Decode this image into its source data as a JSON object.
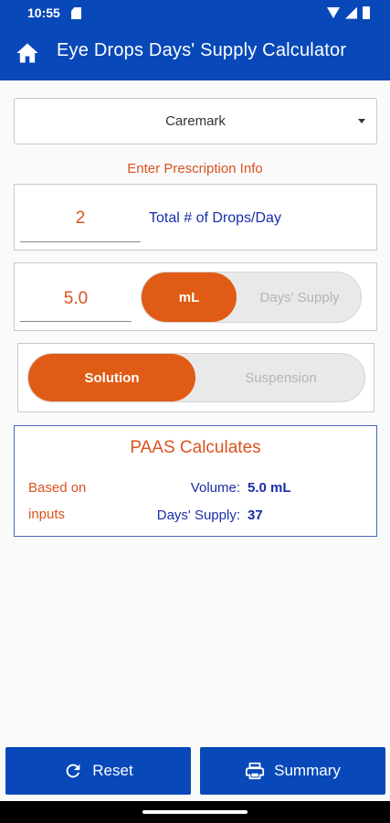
{
  "status_bar": {
    "time": "10:55"
  },
  "app_bar": {
    "title": "Eye Drops Days' Supply Calculator"
  },
  "pbm": {
    "selected": "Caremark"
  },
  "prescription": {
    "section_label": "Enter Prescription Info",
    "drops_per_day": "2",
    "drops_label": "Total # of Drops/Day",
    "volume_value": "5.0",
    "unit_toggle": {
      "selected": "mL",
      "other": "Days' Supply"
    },
    "form_toggle": {
      "selected": "Solution",
      "other": "Suspension"
    }
  },
  "results": {
    "title": "PAAS Calculates",
    "note": "Based on inputs",
    "volume_label": "Volume:",
    "volume_value": "5.0 mL",
    "days_supply_label": "Days' Supply:",
    "days_supply_value": "37"
  },
  "buttons": {
    "reset": "Reset",
    "summary": "Summary"
  },
  "colors": {
    "primary": "#0848b8",
    "accent": "#e05b15",
    "label_blue": "#1a2ea8"
  }
}
